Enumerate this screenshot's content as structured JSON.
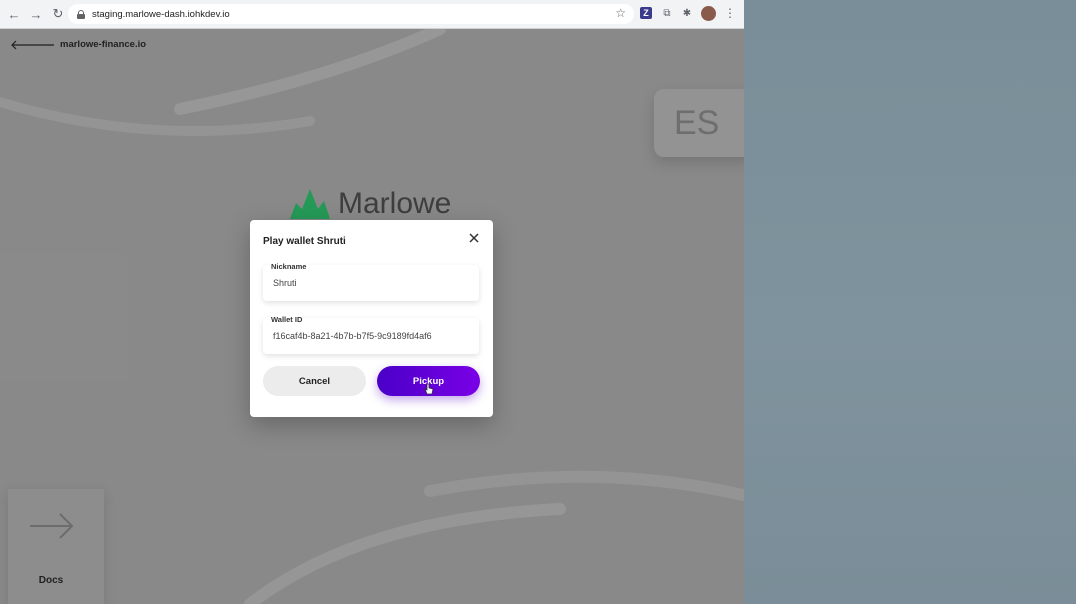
{
  "browser": {
    "url": "staging.marlowe-dash.iohkdev.io",
    "nav": {
      "back_icon": "←",
      "forward_icon": "→",
      "reload_icon": "↻"
    },
    "toolbar_icons": {
      "star": "☆",
      "menu": "⋮",
      "ext_z": "Z",
      "ext_2": "⧉",
      "puzzle": "✱"
    }
  },
  "page": {
    "back_link_label": "marlowe-finance.io",
    "language_badge": "ES",
    "brand_name": "Marlowe",
    "docs_label": "Docs"
  },
  "modal": {
    "title": "Play wallet Shruti",
    "nickname": {
      "label": "Nickname",
      "value": "Shruti"
    },
    "wallet_id": {
      "label": "Wallet ID",
      "value": "f16caf4b-8a21-4b7b-b7f5-9c9189fd4af6"
    },
    "cancel_label": "Cancel",
    "pickup_label": "Pickup"
  },
  "colors": {
    "accent_start": "#4a00c8",
    "accent_end": "#7a00e6",
    "brand_green": "#1f9e55",
    "desktop_bg": "#7d8f9a"
  }
}
